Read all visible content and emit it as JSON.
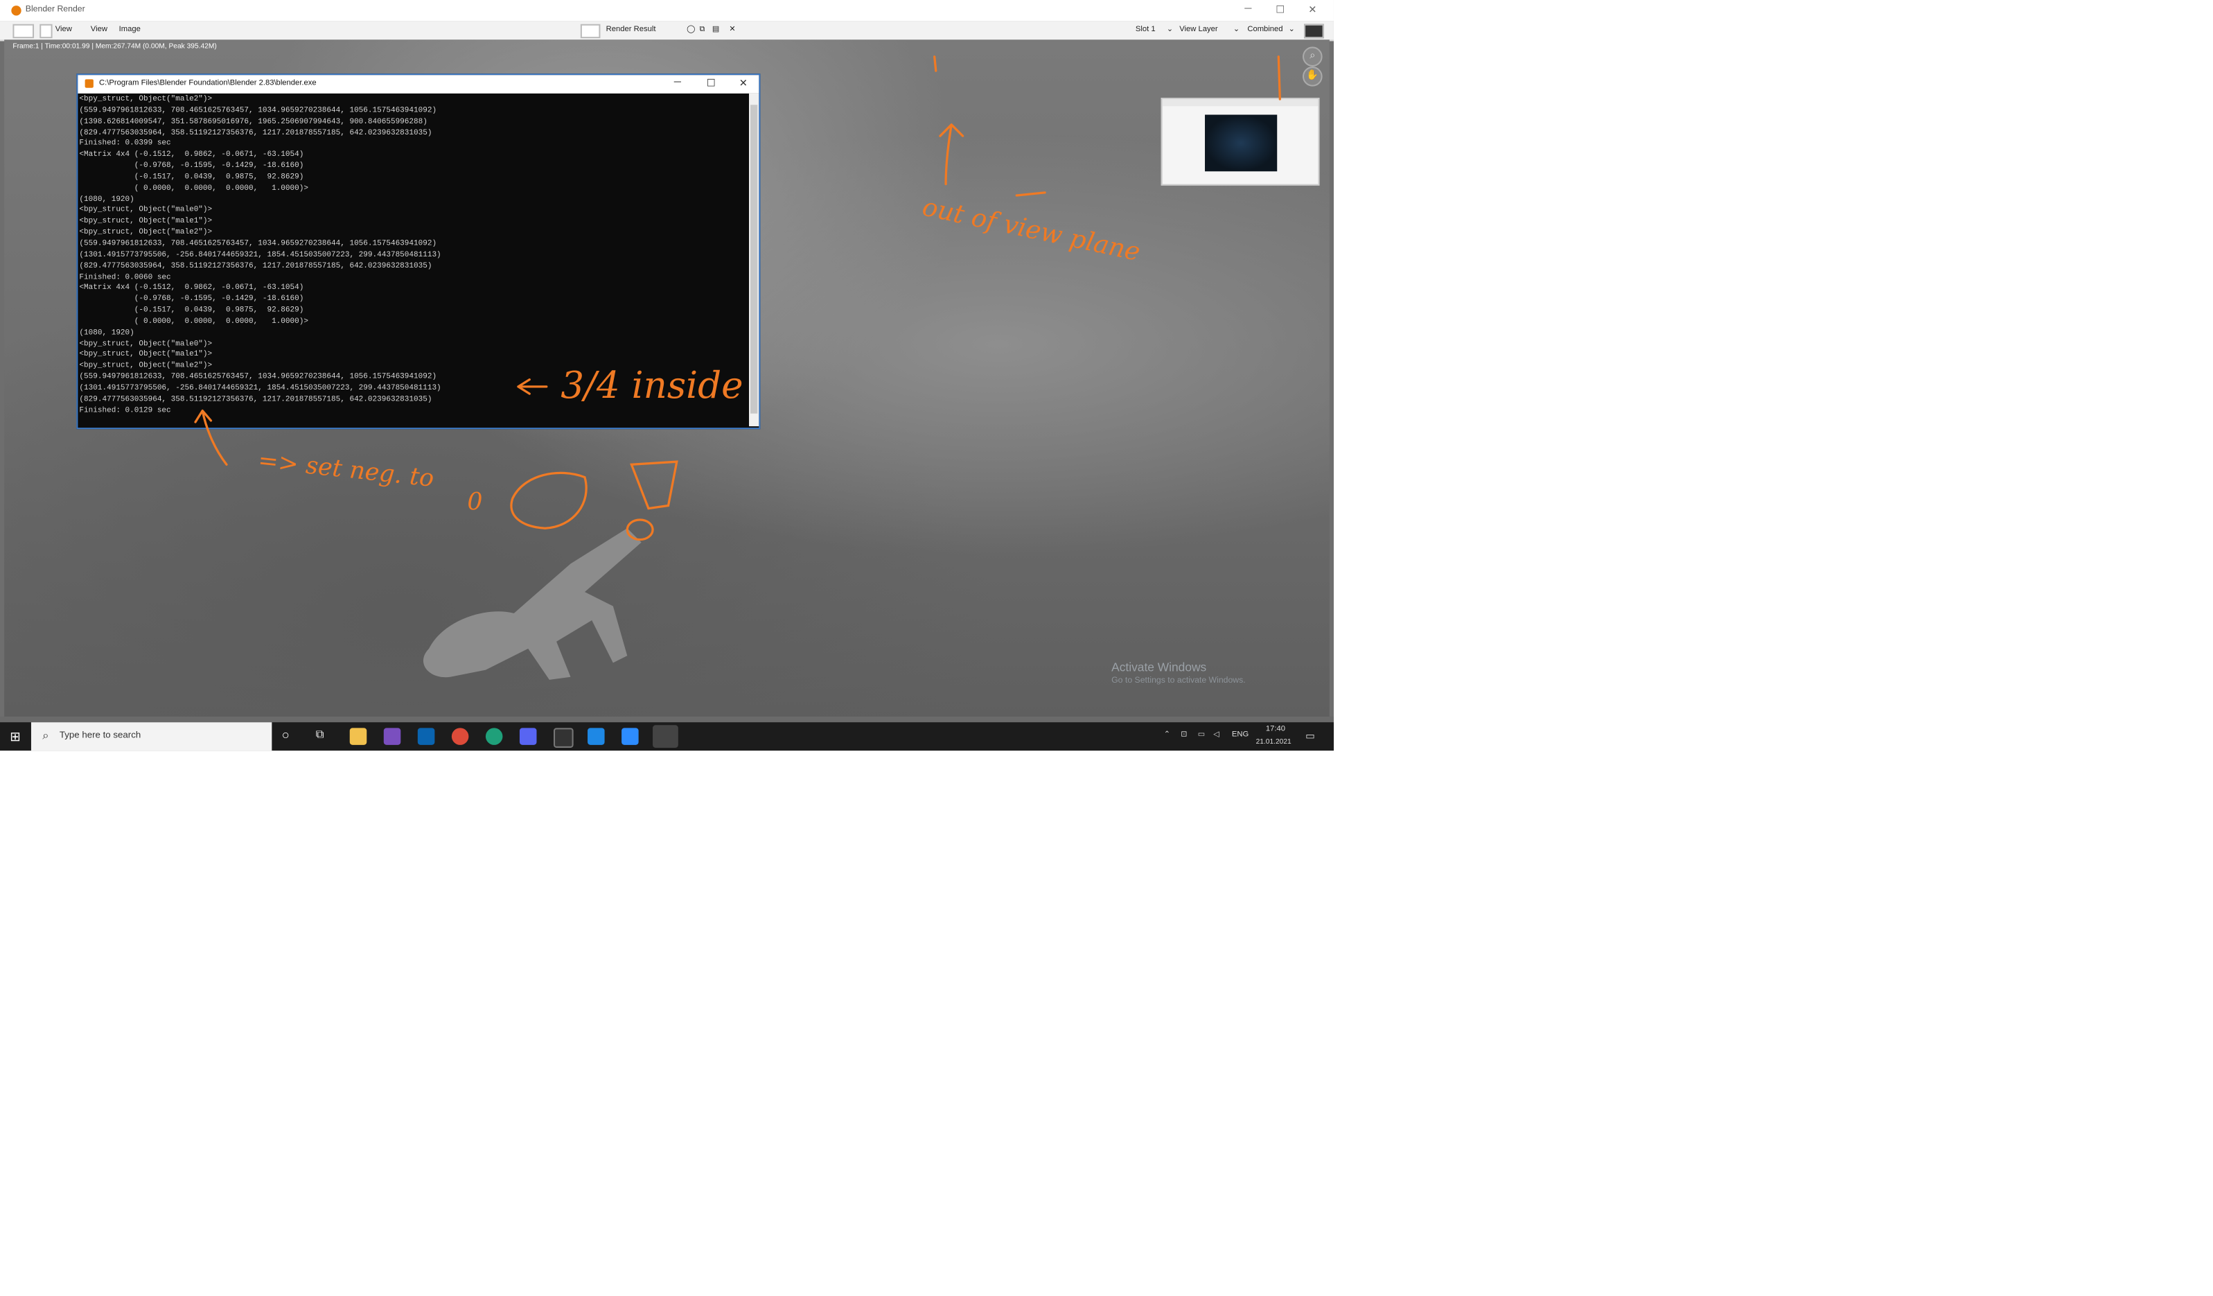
{
  "window": {
    "title": "Blender Render",
    "minimize": "─",
    "maximize": "☐",
    "close": "✕"
  },
  "menubar": {
    "view1": "View",
    "view2": "View",
    "image": "Image",
    "image_name": "Render Result",
    "slot": "Slot 1",
    "view_layer": "View Layer",
    "pass": "Combined"
  },
  "render": {
    "stats": "Frame:1 | Time:00:01.99 | Mem:267.74M (0.00M, Peak 395.42M)",
    "watermark_title": "Activate Windows",
    "watermark_sub": "Go to Settings to activate Windows."
  },
  "console": {
    "title": "C:\\Program Files\\Blender Foundation\\Blender 2.83\\blender.exe",
    "output": "<bpy_struct, Object(\"male2\")>\n(559.9497961812633, 708.4651625763457, 1034.9659270238644, 1056.1575463941092)\n(1398.626814009547, 351.5878695016976, 1965.2506907994643, 900.840655996288)\n(829.4777563035964, 358.51192127356376, 1217.201878557185, 642.0239632831035)\nFinished: 0.0399 sec\n<Matrix 4x4 (-0.1512,  0.9862, -0.0671, -63.1054)\n            (-0.9768, -0.1595, -0.1429, -18.6160)\n            (-0.1517,  0.0439,  0.9875,  92.8629)\n            ( 0.0000,  0.0000,  0.0000,   1.0000)>\n(1080, 1920)\n<bpy_struct, Object(\"male0\")>\n<bpy_struct, Object(\"male1\")>\n<bpy_struct, Object(\"male2\")>\n(559.9497961812633, 708.4651625763457, 1034.9659270238644, 1056.1575463941092)\n(1301.4915773795506, -256.8401744659321, 1854.4515035007223, 299.4437850481113)\n(829.4777563035964, 358.51192127356376, 1217.201878557185, 642.0239632831035)\nFinished: 0.0060 sec\n<Matrix 4x4 (-0.1512,  0.9862, -0.0671, -63.1054)\n            (-0.9768, -0.1595, -0.1429, -18.6160)\n            (-0.1517,  0.0439,  0.9875,  92.8629)\n            ( 0.0000,  0.0000,  0.0000,   1.0000)>\n(1080, 1920)\n<bpy_struct, Object(\"male0\")>\n<bpy_struct, Object(\"male1\")>\n<bpy_struct, Object(\"male2\")>\n(559.9497961812633, 708.4651625763457, 1034.9659270238644, 1056.1575463941092)\n(1301.4915773795506, -256.8401744659321, 1854.4515035007223, 299.4437850481113)\n(829.4777563035964, 358.51192127356376, 1217.201878557185, 642.0239632831035)\nFinished: 0.0129 sec"
  },
  "annotations": {
    "note1": "3/4 inside",
    "note2": "=> set neg. to",
    "note2_num": "0",
    "note3": "out of view plane"
  },
  "taskbar": {
    "search_placeholder": "Type here to search",
    "language": "ENG",
    "time": "17:40",
    "date": "21.01.2021"
  },
  "colors": {
    "annotation": "#f07a24",
    "console_bg": "#0c0c0c",
    "blender_accent": "#e87d0d"
  }
}
